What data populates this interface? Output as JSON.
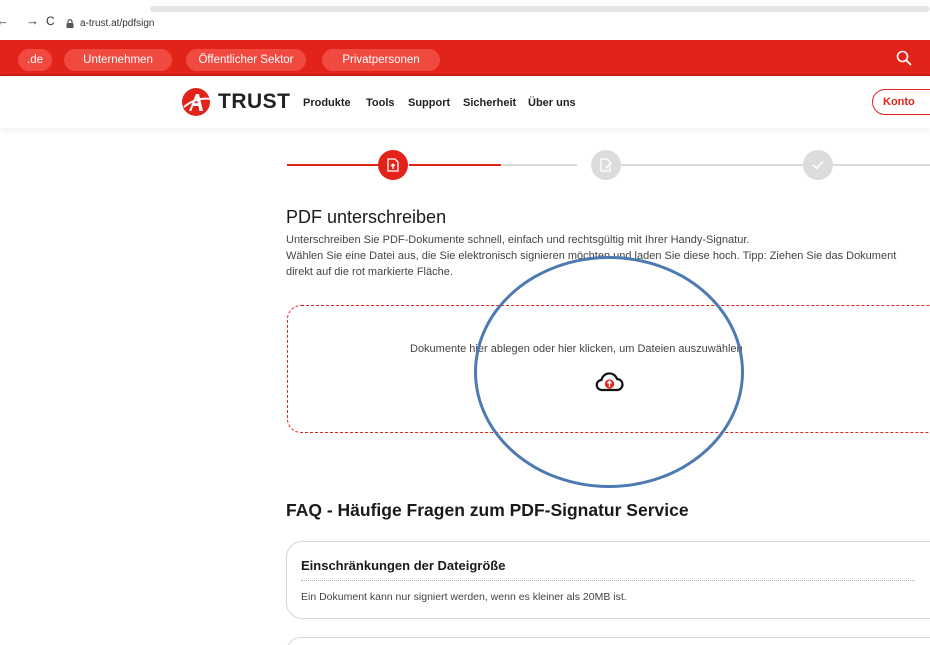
{
  "browser": {
    "back_glyph": "←",
    "forward_glyph": "→",
    "reload_glyph": "C",
    "url": "a-trust.at/pdfsign"
  },
  "sector_nav": {
    "items": [
      ".de",
      "Unternehmen",
      "Öffentlicher Sektor",
      "Privatpersonen"
    ],
    "accent": "#e2231a"
  },
  "header": {
    "logo_text": "TRUST",
    "nav": [
      "Produkte",
      "Tools",
      "Support",
      "Sicherheit",
      "Über uns"
    ],
    "konto_label": "Konto"
  },
  "stepper": {
    "active_step": 1,
    "steps": [
      "upload-document-icon",
      "edit-document-icon",
      "check-icon"
    ]
  },
  "main": {
    "title": "PDF unterschreiben",
    "desc_line1": "Unterschreiben Sie PDF-Dokumente schnell, einfach und rechtsgültig mit Ihrer Handy-Signatur.",
    "desc_line2": "Wählen Sie eine Datei aus, die Sie elektronisch signieren möchten und laden Sie diese hoch. Tipp: Ziehen Sie das Dokument direkt auf die rot markierte Fläche.",
    "dropzone_text": "Dokumente hier ablegen oder hier klicken, um Dateien auszuwählen"
  },
  "faq": {
    "title": "FAQ - Häufige Fragen zum PDF-Signatur Service",
    "items": [
      {
        "question": "Einschränkungen der Dateigröße",
        "answer": "Ein Dokument kann nur signiert werden, wenn es kleiner als 20MB ist."
      }
    ]
  },
  "annotation_color": "#4d7ab0"
}
